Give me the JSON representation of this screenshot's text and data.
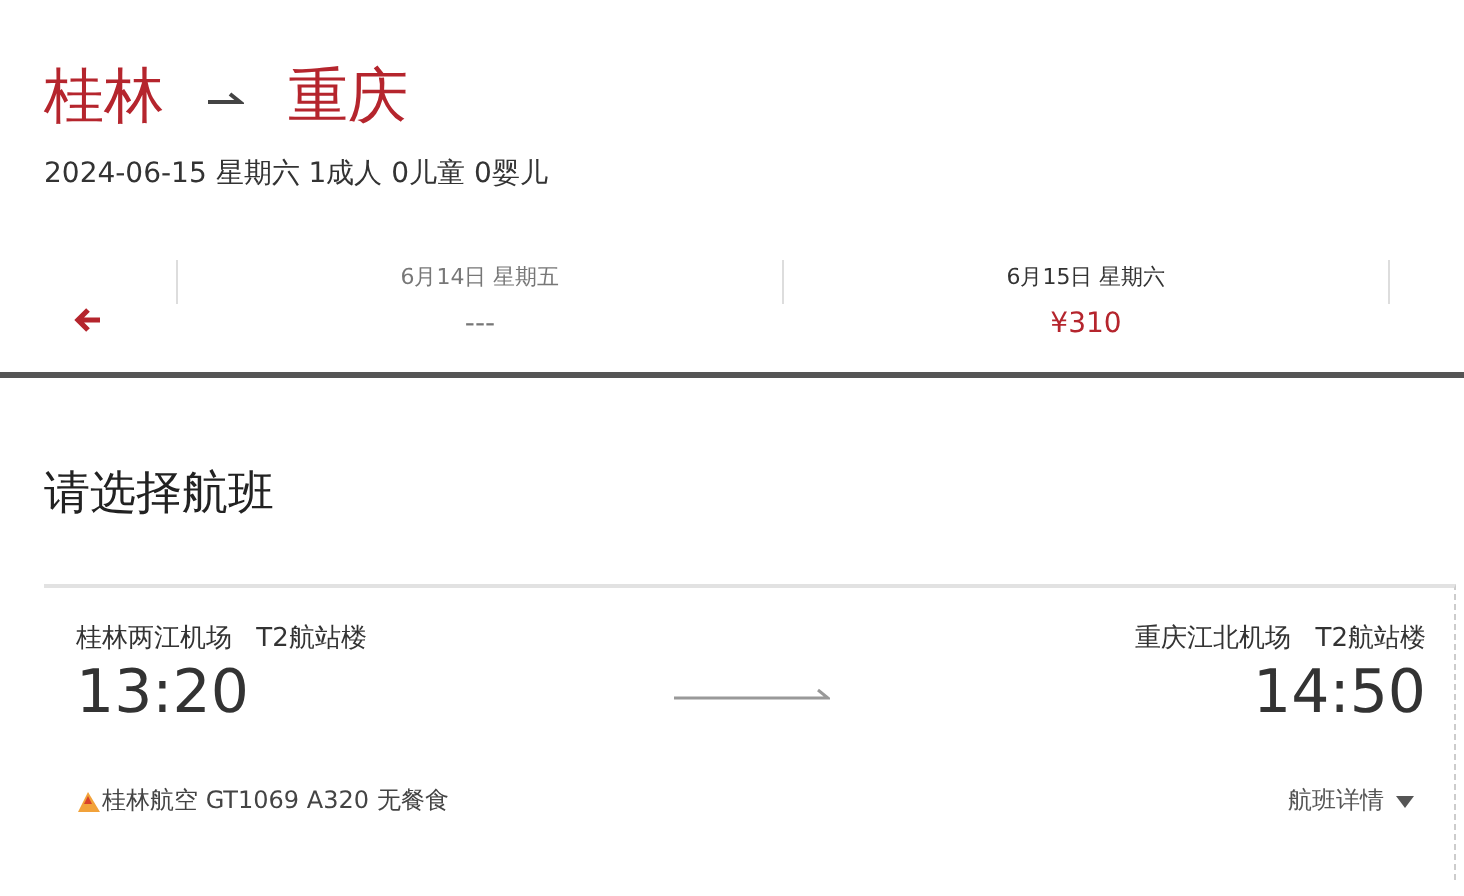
{
  "route": {
    "from": "桂林",
    "to": "重庆"
  },
  "summary": "2024-06-15 星期六 1成人 0儿童 0婴儿",
  "dates": [
    {
      "date": "6月14日 星期五",
      "price": "---",
      "selected": false
    },
    {
      "date": "6月15日 星期六",
      "price": "¥310",
      "selected": true
    }
  ],
  "section_title": "请选择航班",
  "flight": {
    "depart_airport": "桂林两江机场",
    "depart_terminal": "T2航站楼",
    "depart_time": "13:20",
    "arrive_airport": "重庆江北机场",
    "arrive_terminal": "T2航站楼",
    "arrive_time": "14:50",
    "info": "桂林航空 GT1069 A320 无餐食",
    "details_link": "航班详情"
  }
}
